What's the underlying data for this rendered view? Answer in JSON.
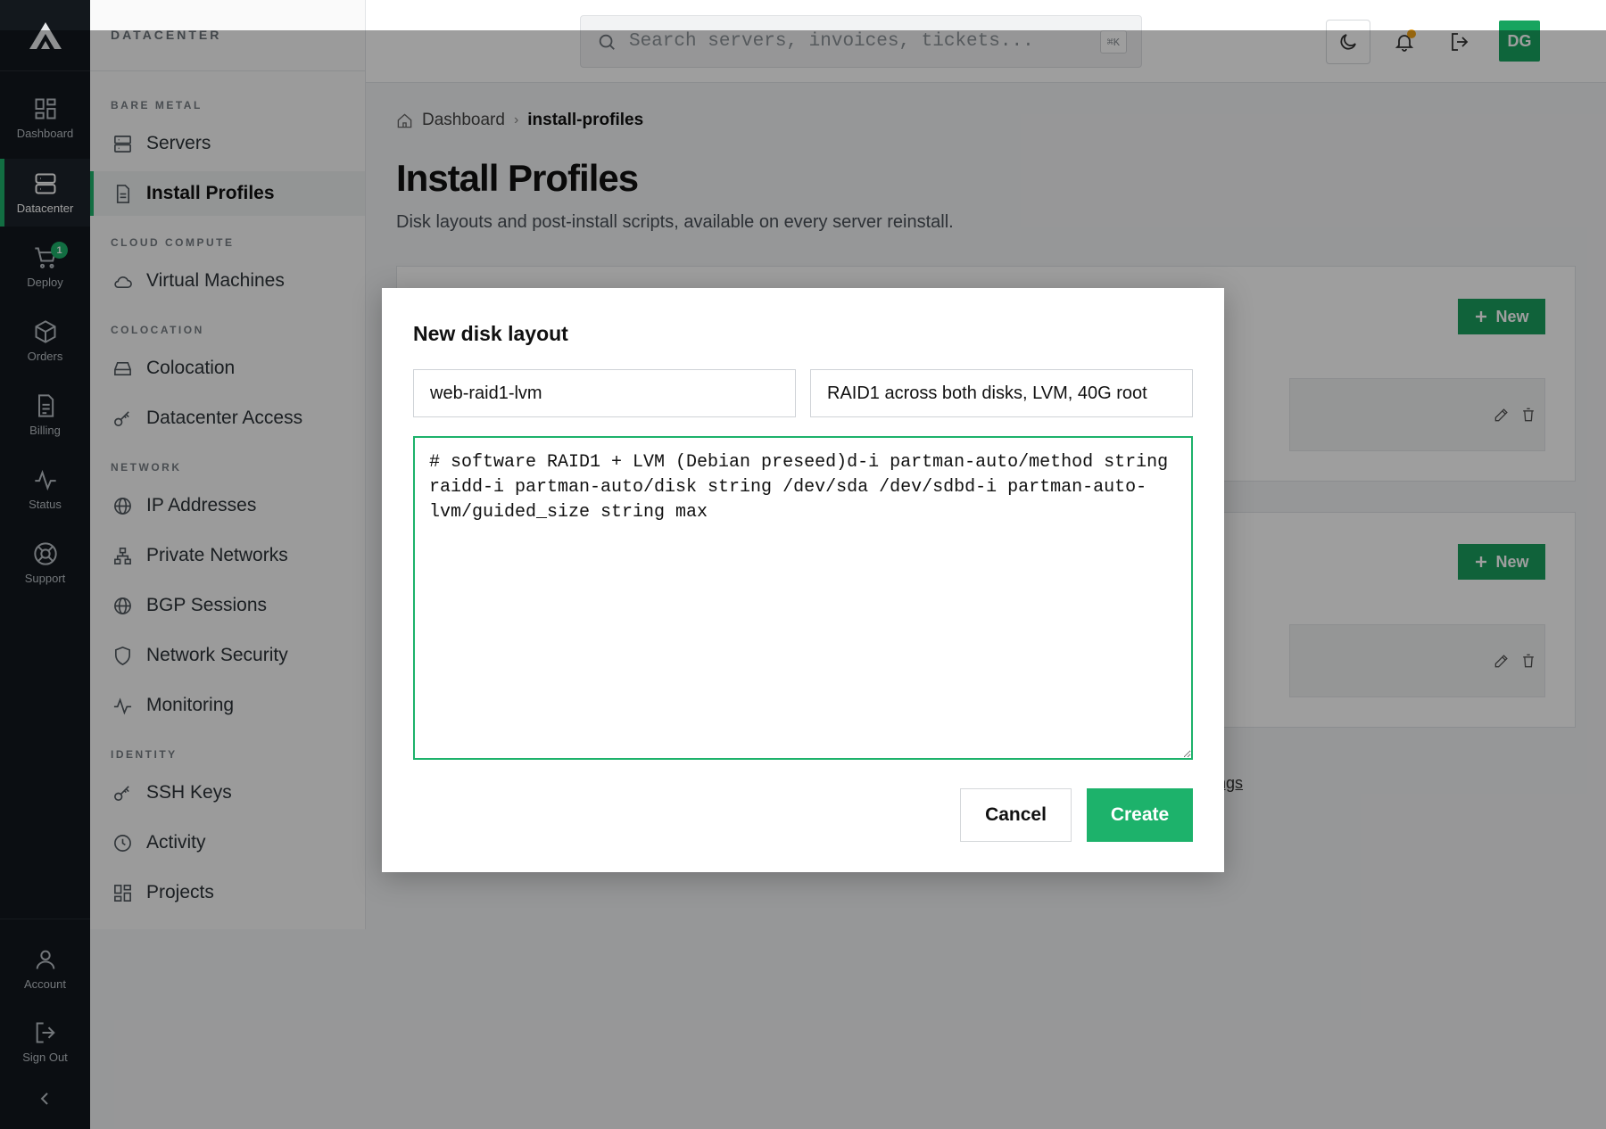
{
  "sidebar_rail": {
    "items": [
      {
        "label": "Dashboard",
        "icon": "grid-icon"
      },
      {
        "label": "Datacenter",
        "icon": "server-icon"
      },
      {
        "label": "Deploy",
        "icon": "cart-icon",
        "badge": "1"
      },
      {
        "label": "Orders",
        "icon": "box-icon"
      },
      {
        "label": "Billing",
        "icon": "document-icon"
      },
      {
        "label": "Status",
        "icon": "pulse-icon"
      },
      {
        "label": "Support",
        "icon": "lifebuoy-icon"
      }
    ],
    "bottom": [
      {
        "label": "Account",
        "icon": "user-icon"
      },
      {
        "label": "Sign Out",
        "icon": "sign-out-icon"
      }
    ]
  },
  "sidenav": {
    "header": "DATACENTER",
    "sections": [
      "BARE METAL",
      "CLOUD COMPUTE",
      "COLOCATION",
      "NETWORK",
      "IDENTITY"
    ],
    "items": [
      "Servers",
      "Install Profiles",
      "Virtual Machines",
      "Colocation",
      "Datacenter Access",
      "IP Addresses",
      "Private Networks",
      "BGP Sessions",
      "Network Security",
      "Monitoring",
      "SSH Keys",
      "Activity",
      "Projects"
    ]
  },
  "topbar": {
    "search_placeholder": "Search servers, invoices, tickets...",
    "search_shortcut": "⌘K",
    "avatar_initials": "DG"
  },
  "main": {
    "breadcrumb": {
      "home": "Dashboard",
      "current": "install-profiles"
    },
    "title": "Install Profiles",
    "subtitle": "Disk layouts and post-install scripts, available on every server reinstall.",
    "new_label": "New",
    "link_fragment": "ngs"
  },
  "modal": {
    "title": "New disk layout",
    "name_value": "web-raid1-lvm",
    "description_value": "RAID1 across both disks, LVM, 40G root",
    "content_value": "# software RAID1 + LVM (Debian preseed)d-i partman-auto/method string raidd-i partman-auto/disk string /dev/sda /dev/sdbd-i partman-auto-lvm/guided_size string max",
    "cancel_label": "Cancel",
    "create_label": "Create"
  },
  "colors": {
    "accent": "#1db26b",
    "rail_bg": "#13181d",
    "notification_dot": "#f0a419"
  }
}
